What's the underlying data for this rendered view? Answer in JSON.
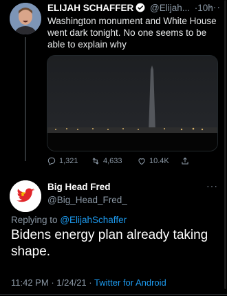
{
  "parent_tweet": {
    "author_name": "ELIJAH SCHAFFER",
    "handle_truncated": "@Elijah...",
    "time": "10h",
    "more": "···",
    "separator": "·",
    "text": "Washington monument and White House went dark tonight. No one seems to be able to explain why",
    "media_icon": "night-photo-washington-monument",
    "stats": {
      "replies": "1,321",
      "retweets": "4,633",
      "likes": "10.4K"
    }
  },
  "reply_tweet": {
    "author_name": "Big Head Fred",
    "handle": "@Big_Head_Fred_",
    "more": "···",
    "replying_prefix": "Replying to",
    "replying_to": "@ElijahSchaffer",
    "text": "Bidens energy plan already taking shape.",
    "time": "11:42 PM",
    "date": "1/24/21",
    "source": "Twitter for Android",
    "sep": "·"
  },
  "colors": {
    "background": "#000000",
    "accent": "#1d9bf0",
    "muted": "#8b98a5"
  }
}
